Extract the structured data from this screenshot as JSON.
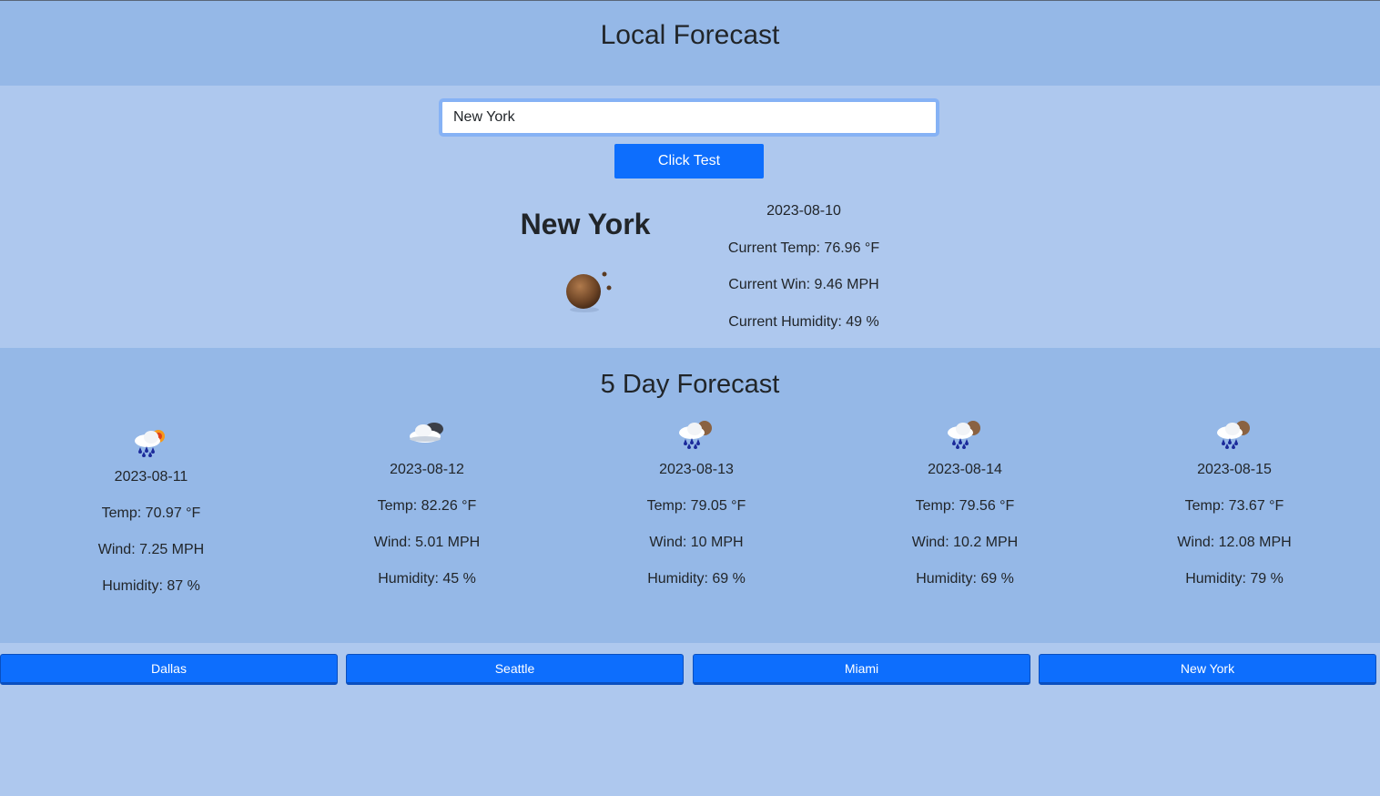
{
  "header": {
    "title": "Local Forecast"
  },
  "search": {
    "value": "New York",
    "button_label": "Click Test"
  },
  "current": {
    "city": "New York",
    "date": "2023-08-10",
    "temp": "Current Temp: 76.96 °F",
    "wind": "Current Win: 9.46 MPH",
    "humidity": "Current Humidity: 49 %",
    "icon": "moon-night-icon"
  },
  "forecast": {
    "title": "5 Day Forecast",
    "days": [
      {
        "date": "2023-08-11",
        "temp": "Temp: 70.97 °F",
        "wind": "Wind: 7.25 MPH",
        "humidity": "Humidity: 87 %",
        "icon": "rain-sun-icon"
      },
      {
        "date": "2023-08-12",
        "temp": "Temp: 82.26 °F",
        "wind": "Wind: 5.01 MPH",
        "humidity": "Humidity: 45 %",
        "icon": "cloudy-icon"
      },
      {
        "date": "2023-08-13",
        "temp": "Temp: 79.05 °F",
        "wind": "Wind: 10 MPH",
        "humidity": "Humidity: 69 %",
        "icon": "rain-night-icon"
      },
      {
        "date": "2023-08-14",
        "temp": "Temp: 79.56 °F",
        "wind": "Wind: 10.2 MPH",
        "humidity": "Humidity: 69 %",
        "icon": "rain-night-icon"
      },
      {
        "date": "2023-08-15",
        "temp": "Temp: 73.67 °F",
        "wind": "Wind: 12.08 MPH",
        "humidity": "Humidity: 79 %",
        "icon": "rain-night-icon"
      }
    ]
  },
  "history": {
    "cities": [
      "Dallas",
      "Seattle",
      "Miami",
      "New York"
    ]
  },
  "colors": {
    "accent": "#0d6efd",
    "header_bg": "#95b8e7",
    "page_bg": "#aec8ee"
  }
}
